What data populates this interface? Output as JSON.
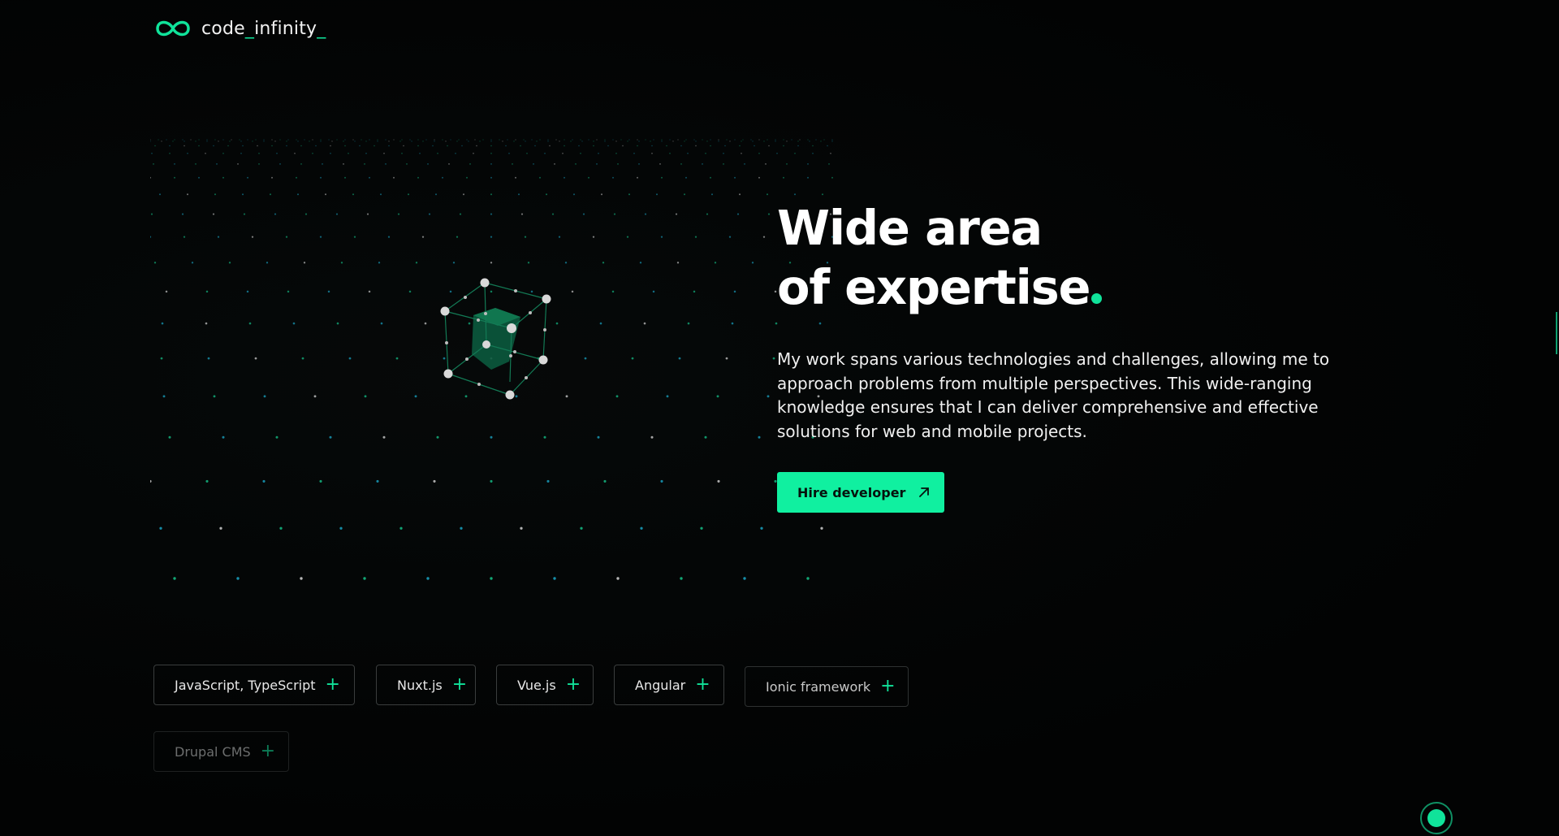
{
  "brand": {
    "name": "code",
    "name_suffix": "infinity",
    "logo_icon": "infinity-icon",
    "accent_color": "#10e39a"
  },
  "hero": {
    "title_line1": "Wide area",
    "title_line2_prefix": "of ",
    "title_highlight": "expertise",
    "description": "My work spans various technologies and challenges, allowing me to approach problems from multiple perspectives. This wide-ranging knowledge ensures that I can deliver comprehensive and effective solutions for web and mobile projects.",
    "cta_label": "Hire developer",
    "cta_icon": "arrow-up-right-icon",
    "illustration": "wireframe-cube-icon"
  },
  "tags": [
    {
      "label": "JavaScript, TypeScript"
    },
    {
      "label": "Nuxt.js"
    },
    {
      "label": "Vue.js"
    },
    {
      "label": "Angular"
    },
    {
      "label": "Ionic framework"
    },
    {
      "label": "Drupal CMS"
    }
  ],
  "scroll_indicator_icon": "scroll-dot-icon"
}
